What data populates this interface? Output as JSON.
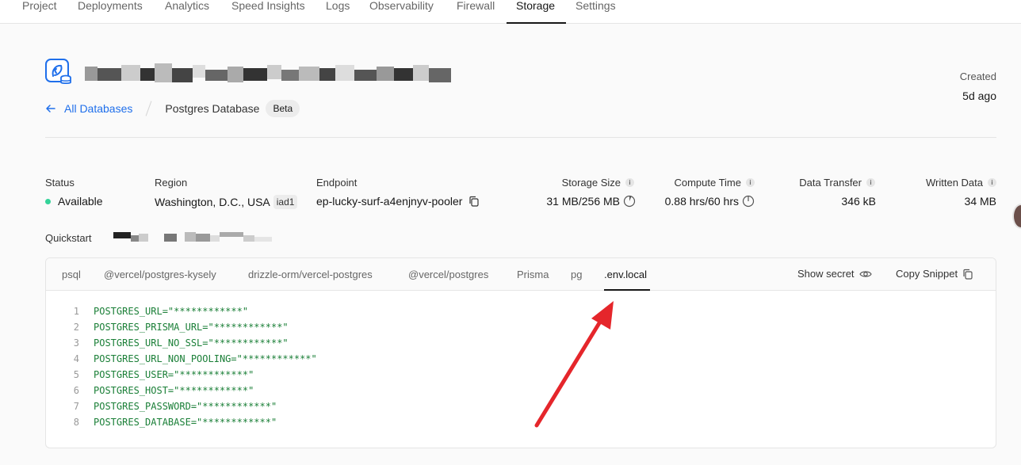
{
  "nav": {
    "tabs": [
      "Project",
      "Deployments",
      "Analytics",
      "Speed Insights",
      "Logs",
      "Observability",
      "Firewall",
      "Storage",
      "Settings"
    ],
    "active": "Storage"
  },
  "header": {
    "created_label": "Created",
    "created_value": "5d ago"
  },
  "breadcrumb": {
    "back_label": "All Databases",
    "current": "Postgres Database",
    "badge": "Beta"
  },
  "stats": {
    "status_label": "Status",
    "status_value": "Available",
    "region_label": "Region",
    "region_value": "Washington, D.C., USA",
    "region_code": "iad1",
    "endpoint_label": "Endpoint",
    "endpoint_value": "ep-lucky-surf-a4enjnyv-pooler",
    "storage_label": "Storage Size",
    "storage_value": "31 MB/256 MB",
    "compute_label": "Compute Time",
    "compute_value": "0.88 hrs/60 hrs",
    "transfer_label": "Data Transfer",
    "transfer_value": "346 kB",
    "written_label": "Written Data",
    "written_value": "34 MB"
  },
  "quickstart": {
    "label": "Quickstart"
  },
  "panel": {
    "tabs": [
      "psql",
      "@vercel/postgres-kysely",
      "drizzle-orm/vercel-postgres",
      "@vercel/postgres",
      "Prisma",
      "pg",
      ".env.local"
    ],
    "active": ".env.local",
    "show_secret": "Show secret",
    "copy_snippet": "Copy Snippet",
    "lines": [
      {
        "n": "1",
        "text": "POSTGRES_URL=\"************\""
      },
      {
        "n": "2",
        "text": "POSTGRES_PRISMA_URL=\"************\""
      },
      {
        "n": "3",
        "text": "POSTGRES_URL_NO_SSL=\"************\""
      },
      {
        "n": "4",
        "text": "POSTGRES_URL_NON_POOLING=\"************\""
      },
      {
        "n": "5",
        "text": "POSTGRES_USER=\"************\""
      },
      {
        "n": "6",
        "text": "POSTGRES_HOST=\"************\""
      },
      {
        "n": "7",
        "text": "POSTGRES_PASSWORD=\"************\""
      },
      {
        "n": "8",
        "text": "POSTGRES_DATABASE=\"************\""
      }
    ]
  },
  "colors": {
    "accent": "#1f6feb",
    "status_available": "#34d399",
    "code_text": "#1a7f37",
    "annotation": "#e5262b"
  }
}
